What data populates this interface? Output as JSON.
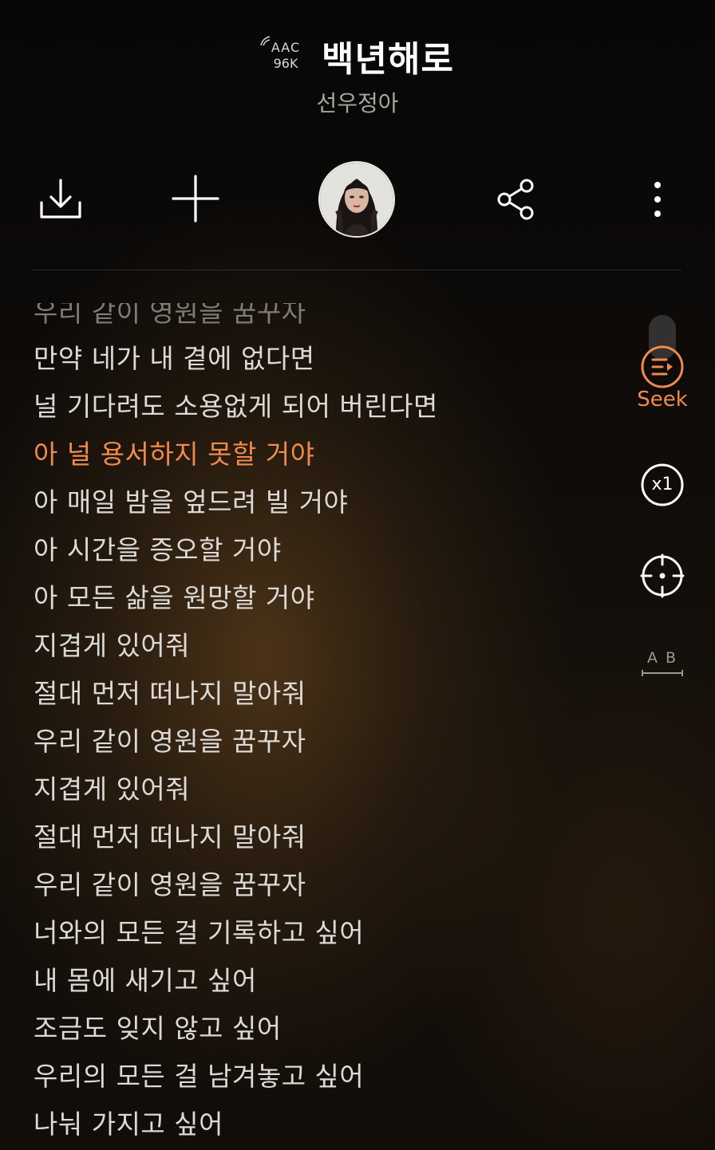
{
  "header": {
    "codec_format": "AAC",
    "codec_rate": "96K",
    "song_title": "백년해로",
    "artist": "선우정아"
  },
  "actions": {
    "download_icon": "download-icon",
    "add_icon": "plus-icon",
    "avatar": "artist-avatar",
    "share_icon": "share-icon",
    "more_icon": "more-vertical-icon"
  },
  "lyrics": {
    "lines": [
      "우리 같이 영원을 꿈꾸자",
      "만약 네가 내 곁에 없다면",
      "널 기다려도 소용없게 되어 버린다면",
      "아 널 용서하지 못할 거야",
      "아 매일 밤을 엎드려 빌 거야",
      "아 시간을 증오할 거야",
      "아 모든 삶을 원망할 거야",
      "지겹게 있어줘",
      "절대 먼저 떠나지 말아줘",
      "우리 같이 영원을 꿈꾸자",
      "지겹게 있어줘",
      "절대 먼저 떠나지 말아줘",
      "우리 같이 영원을 꿈꾸자",
      "너와의 모든 걸 기록하고 싶어",
      "내 몸에 새기고 싶어",
      "조금도 잊지 않고 싶어",
      "우리의 모든 걸 남겨놓고 싶어",
      "나눠 가지고 싶어"
    ],
    "current_index": 3
  },
  "controls": {
    "seek_label": "Seek",
    "speed_label": "x1",
    "ab_label": "A B"
  },
  "colors": {
    "accent": "#f08a4b",
    "text": "#dcdad6",
    "subtext": "#a8a49f"
  }
}
